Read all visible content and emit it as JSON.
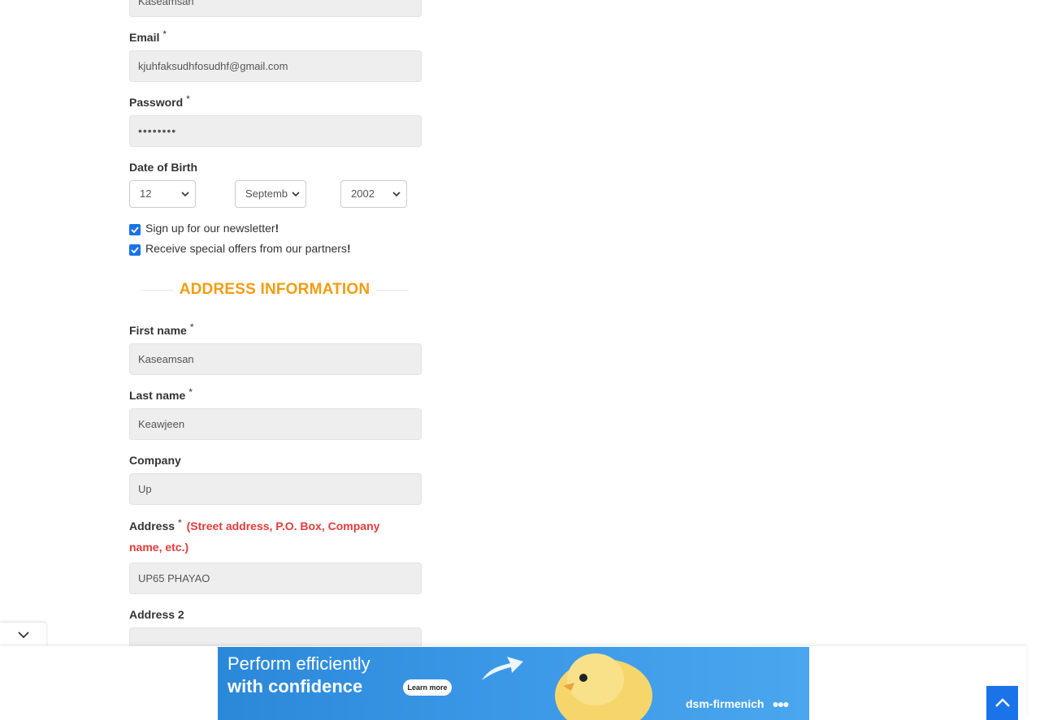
{
  "account": {
    "first_name_value": "Kaseamsan",
    "email_label": "Email",
    "email_value": "kjuhfaksudhfosudhf@gmail.com",
    "password_label": "Password",
    "password_value": "••••••••",
    "required_mark": "*",
    "dob_label": "Date of Birth",
    "dob_day": "12",
    "dob_month": "Septemb",
    "dob_year": "2002",
    "newsletter_text": "Sign up for our newsletter",
    "offers_text": "Receive special offers from our partners",
    "exclaim": "!"
  },
  "address": {
    "section_title": "ADDRESS INFORMATION",
    "first_name_label": "First name",
    "first_name_value": "Kaseamsan",
    "last_name_label": "Last name",
    "last_name_value": "Keawjeen",
    "company_label": "Company",
    "company_value": "Up",
    "address_label": "Address",
    "address_hint": "(Street address, P.O. Box, Company name, etc.)",
    "address_value": "UP65 PHAYAO",
    "address2_label": "Address 2"
  },
  "ad": {
    "line1": "Perform efficiently",
    "line2": "with confidence",
    "button": "Learn more",
    "brand": "dsm-firmenich"
  },
  "colors": {
    "accent": "#f39c12",
    "hint": "#e23b3b",
    "checkbox": "#1a73e8",
    "ad_bg": "#2b88d8"
  },
  "icons": [
    "chevron-down-icon",
    "check-icon",
    "arrow-up-icon",
    "chick-image",
    "arrow-image"
  ]
}
